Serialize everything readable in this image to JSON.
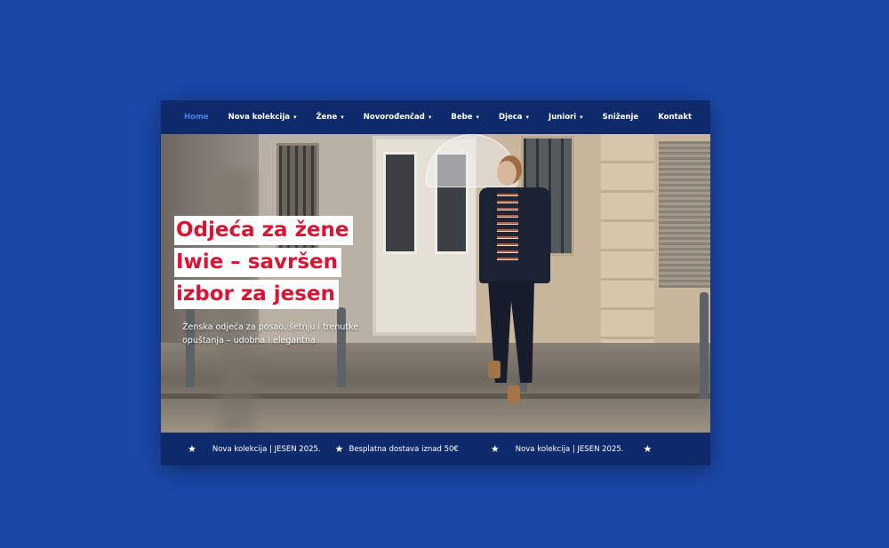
{
  "nav": {
    "items": [
      {
        "label": "Home",
        "dropdown": false,
        "active": true
      },
      {
        "label": "Nova kolekcija",
        "dropdown": true,
        "active": false
      },
      {
        "label": "Žene",
        "dropdown": true,
        "active": false
      },
      {
        "label": "Novorođenčad",
        "dropdown": true,
        "active": false
      },
      {
        "label": "Bebe",
        "dropdown": true,
        "active": false
      },
      {
        "label": "Djeca",
        "dropdown": true,
        "active": false
      },
      {
        "label": "Juniori",
        "dropdown": true,
        "active": false
      },
      {
        "label": "Sniženje",
        "dropdown": false,
        "active": false
      },
      {
        "label": "Kontakt",
        "dropdown": false,
        "active": false
      }
    ],
    "chevron": "▾"
  },
  "hero": {
    "headline": [
      "Odjeća za žene",
      "Iwie – savršen",
      "izbor za jesen"
    ],
    "subtext": "Ženska odjeća za posao, šetnju i trenutke opuštanja – udobna i elegantna."
  },
  "ticker": {
    "star": "★",
    "items": [
      "Nova kolekcija | JESEN 2025.",
      "Besplatna dostava iznad 50€",
      "Nova kolekcija | JESEN 2025."
    ]
  },
  "colors": {
    "page_bg": "#1a47a8",
    "bar_bg": "#0f2a6b",
    "active_nav": "#4a7df2",
    "headline_red": "#dc1433"
  }
}
